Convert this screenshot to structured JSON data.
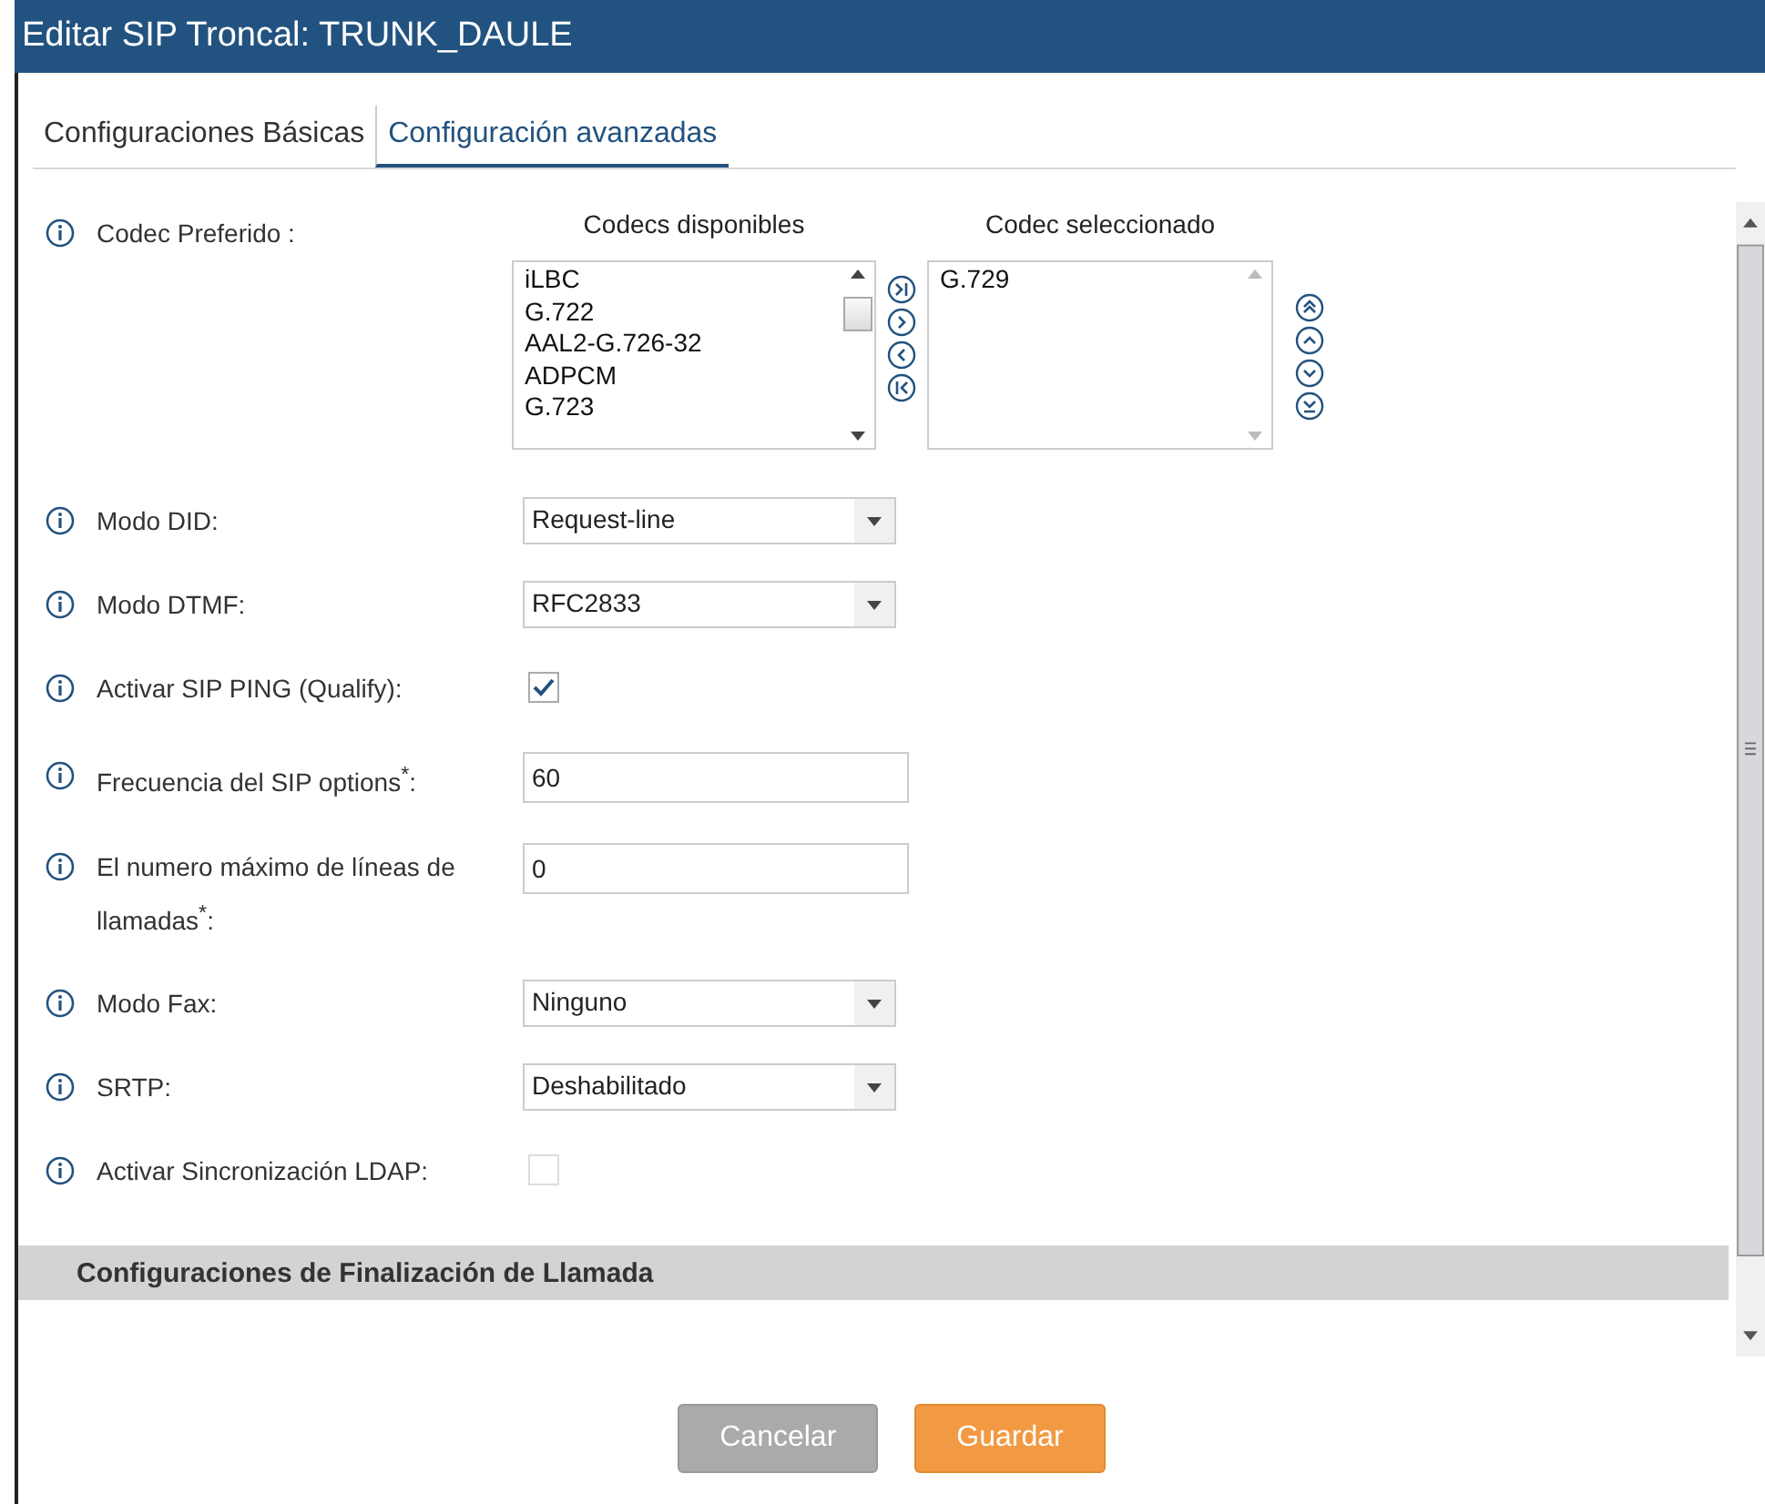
{
  "window": {
    "title": "Editar SIP Troncal: TRUNK_DAULE"
  },
  "tabs": [
    {
      "label": "Configuraciones Básicas",
      "selected": false
    },
    {
      "label": "Configuración avanzadas",
      "selected": true
    }
  ],
  "fields": [
    {
      "kind": "codec",
      "label": "Codec Preferido :",
      "available_title": "Codecs disponibles",
      "available": [
        "iLBC",
        "G.722",
        "AAL2-G.726-32",
        "ADPCM",
        "G.723"
      ],
      "selected_title": "Codec seleccionado",
      "chosen": [
        "G.729"
      ]
    },
    {
      "kind": "select",
      "label": "Modo DID:",
      "value": "Request-line"
    },
    {
      "kind": "select",
      "label": "Modo DTMF:",
      "value": "RFC2833"
    },
    {
      "kind": "checkbox",
      "label": "Activar SIP PING (Qualify):",
      "checked": true
    },
    {
      "kind": "text",
      "label": "Frecuencia del SIP options$^{*}$:",
      "value": "60"
    },
    {
      "kind": "text",
      "label": "El numero máximo de líneas de llamadas$^{*}$:",
      "value": "0"
    },
    {
      "kind": "select",
      "label": "Modo Fax:",
      "value": "Ninguno"
    },
    {
      "kind": "select",
      "label": "SRTP:",
      "value": "Deshabilitado"
    },
    {
      "kind": "checkbox",
      "label": "Activar Sincronización LDAP:",
      "checked": false
    }
  ],
  "section": {
    "title": "Configuraciones de Finalización de Llamada"
  },
  "buttons": [
    {
      "label": "Cancelar",
      "kind": "secondary"
    },
    {
      "label": "Guardar",
      "kind": "primary"
    }
  ]
}
